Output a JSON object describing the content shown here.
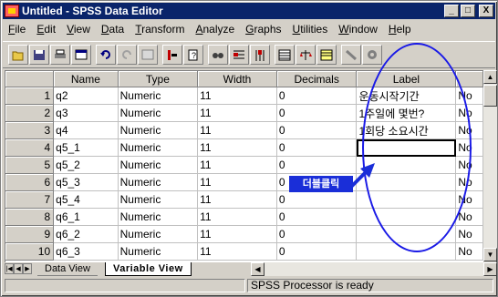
{
  "window": {
    "title": "Untitled - SPSS Data Editor",
    "controls": [
      "_",
      "□",
      "X"
    ]
  },
  "menu": {
    "items": [
      {
        "key": "F",
        "rest": "ile"
      },
      {
        "key": "E",
        "rest": "dit"
      },
      {
        "key": "V",
        "rest": "iew"
      },
      {
        "key": "D",
        "rest": "ata"
      },
      {
        "key": "T",
        "rest": "ransform"
      },
      {
        "key": "A",
        "rest": "nalyze"
      },
      {
        "key": "G",
        "rest": "raphs"
      },
      {
        "key": "U",
        "rest": "tilities"
      },
      {
        "key": "W",
        "rest": "indow"
      },
      {
        "key": "H",
        "rest": "elp"
      }
    ]
  },
  "toolbar": {
    "icons": [
      "open-icon",
      "save-icon",
      "print-icon",
      "dialog-recall-icon",
      "undo-icon",
      "redo-icon",
      "goto-chart-icon",
      "goto-case-icon",
      "variables-icon",
      "find-icon",
      "insert-case-icon",
      "insert-variable-icon",
      "split-file-icon",
      "weight-cases-icon",
      "select-cases-icon",
      "value-labels-icon",
      "use-sets-icon"
    ]
  },
  "grid": {
    "columns": [
      "Name",
      "Type",
      "Width",
      "Decimals",
      "Label",
      ""
    ],
    "rows": [
      {
        "num": "1",
        "name": "q2",
        "type": "Numeric",
        "width": "11",
        "decimals": "0",
        "label": "운동시작기간",
        "extra": "No"
      },
      {
        "num": "2",
        "name": "q3",
        "type": "Numeric",
        "width": "11",
        "decimals": "0",
        "label": "1주일에 몇번?",
        "extra": "No"
      },
      {
        "num": "3",
        "name": "q4",
        "type": "Numeric",
        "width": "11",
        "decimals": "0",
        "label": "1회당 소요시간",
        "extra": "No"
      },
      {
        "num": "4",
        "name": "q5_1",
        "type": "Numeric",
        "width": "11",
        "decimals": "0",
        "label": "",
        "extra": "No"
      },
      {
        "num": "5",
        "name": "q5_2",
        "type": "Numeric",
        "width": "11",
        "decimals": "0",
        "label": "",
        "extra": "No"
      },
      {
        "num": "6",
        "name": "q5_3",
        "type": "Numeric",
        "width": "11",
        "decimals": "0",
        "label": "",
        "extra": "No"
      },
      {
        "num": "7",
        "name": "q5_4",
        "type": "Numeric",
        "width": "11",
        "decimals": "0",
        "label": "",
        "extra": "No"
      },
      {
        "num": "8",
        "name": "q6_1",
        "type": "Numeric",
        "width": "11",
        "decimals": "0",
        "label": "",
        "extra": "No"
      },
      {
        "num": "9",
        "name": "q6_2",
        "type": "Numeric",
        "width": "11",
        "decimals": "0",
        "label": "",
        "extra": "No"
      },
      {
        "num": "10",
        "name": "q6_3",
        "type": "Numeric",
        "width": "11",
        "decimals": "0",
        "label": "",
        "extra": "No"
      }
    ],
    "selected_row": 4,
    "selected_column": "label"
  },
  "tabs": {
    "data_view": "Data View",
    "variable_view": "Variable View",
    "active": "Variable View"
  },
  "status": {
    "processor": "SPSS Processor  is ready"
  },
  "annotation": {
    "callout_text": "더블클릭",
    "highlight_color": "#1a1ae6",
    "callout_color": "#1a2ed8"
  },
  "colors": {
    "titlebar": "#0a246a",
    "chrome": "#d4d0c8"
  }
}
